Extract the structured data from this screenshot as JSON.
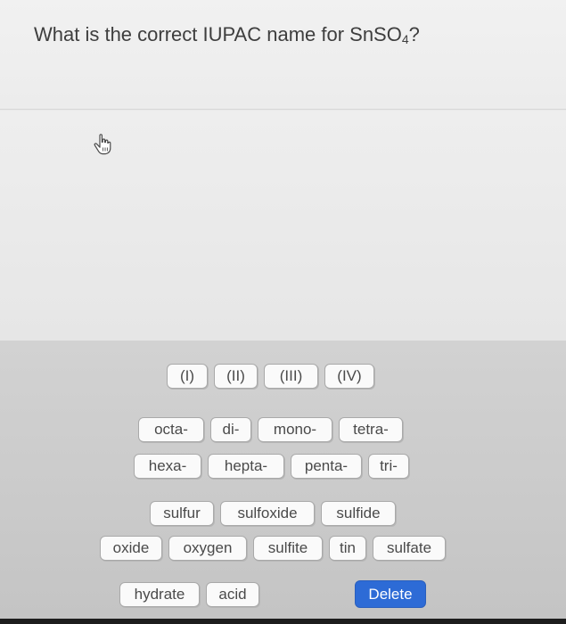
{
  "question": {
    "prefix": "What is the correct IUPAC name for SnSO",
    "subscript": "4",
    "suffix": "?"
  },
  "icons": {
    "cursor": "hand-pointer-icon"
  },
  "tiles": {
    "roman_numerals": [
      "(I)",
      "(II)",
      "(III)",
      "(IV)"
    ],
    "prefixes_row1": [
      "octa-",
      "di-",
      "mono-",
      "tetra-"
    ],
    "prefixes_row2": [
      "hexa-",
      "hepta-",
      "penta-",
      "tri-"
    ],
    "names_row1": [
      "sulfur",
      "sulfoxide",
      "sulfide"
    ],
    "names_row2": [
      "oxide",
      "oxygen",
      "sulfite",
      "tin",
      "sulfate"
    ],
    "extras": [
      "hydrate",
      "acid"
    ]
  },
  "actions": {
    "delete_label": "Delete"
  },
  "colors": {
    "delete_button": "#2d6bd6",
    "tile_background": "#fafafa",
    "tray_background": "#cbcbcb"
  }
}
